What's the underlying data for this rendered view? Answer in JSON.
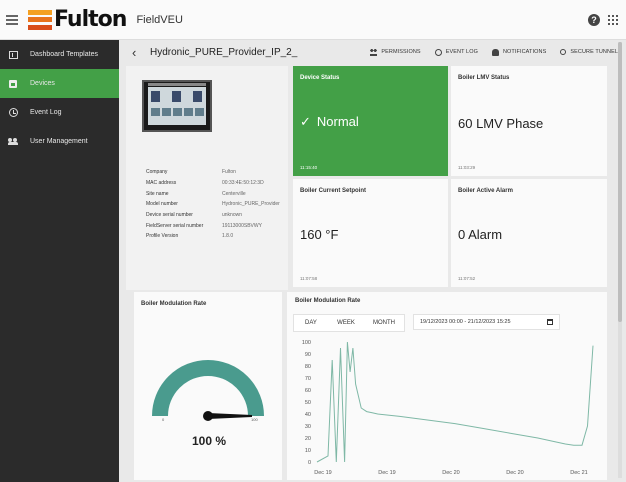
{
  "header": {
    "brand": "Fulton",
    "app_name": "FieldVEU",
    "help_icon": "help-icon",
    "apps_icon": "apps-grid-icon"
  },
  "sidebar": {
    "items": [
      {
        "label": "Dashboard Templates",
        "icon": "dashboard-icon",
        "active": false
      },
      {
        "label": "Devices",
        "icon": "device-icon",
        "active": true
      },
      {
        "label": "Event Log",
        "icon": "history-icon",
        "active": false
      },
      {
        "label": "User Management",
        "icon": "users-icon",
        "active": false
      }
    ]
  },
  "page": {
    "title": "Hydronic_PURE_Provider_IP_2_",
    "actions": [
      {
        "label": "PERMISSIONS",
        "icon": "people-icon"
      },
      {
        "label": "EVENT LOG",
        "icon": "history-icon"
      },
      {
        "label": "NOTIFICATIONS",
        "icon": "bell-icon"
      },
      {
        "label": "SECURE TUNNEL",
        "icon": "key-icon"
      }
    ]
  },
  "device": {
    "info": [
      {
        "label": "Company",
        "value": "Fulton"
      },
      {
        "label": "MAC address",
        "value": "00:33:4E:50:12:3D"
      },
      {
        "label": "Site name",
        "value": "Centerville"
      },
      {
        "label": "Model number",
        "value": "Hydronic_PURE_Provider"
      },
      {
        "label": "Device serial number",
        "value": "unknown"
      },
      {
        "label": "FieldServer serial number",
        "value": "19113000SBVWY"
      },
      {
        "label": "Profile Version",
        "value": "1.8.0"
      }
    ]
  },
  "cards": [
    {
      "title": "Device Status",
      "value": "Normal",
      "time": "11:15:40",
      "status_color": "#43a047"
    },
    {
      "title": "Boiler LMV Status",
      "value": "60 LMV Phase",
      "time": "11:03:29"
    },
    {
      "title": "Boiler Current Setpoint",
      "value": "160 °F",
      "time": "11:07:58"
    },
    {
      "title": "Boiler Active Alarm",
      "value": "0 Alarm",
      "time": "11:07:52"
    }
  ],
  "gauge": {
    "title": "Boiler Modulation Rate",
    "value_text": "100 %",
    "value": 100,
    "min_label": "0",
    "max_label": "100",
    "color": "#4a9b8e"
  },
  "trend": {
    "title": "Boiler Modulation Rate",
    "range_buttons": [
      "DAY",
      "WEEK",
      "MONTH"
    ],
    "date_range": "19/12/2023 00:00 - 21/12/2023 15:25"
  },
  "chart_data": {
    "type": "line",
    "title": "Boiler Modulation Rate",
    "xlabel": "",
    "ylabel": "",
    "ylim": [
      0,
      100
    ],
    "yticks": [
      0,
      10,
      20,
      30,
      40,
      50,
      60,
      70,
      80,
      90,
      100
    ],
    "xtick_labels": [
      "Dec 19",
      "Dec 19",
      "Dec 20",
      "Dec 20",
      "Dec 21"
    ],
    "grid": false,
    "color": "#7fb8a6",
    "x": [
      0.0,
      0.04,
      0.055,
      0.07,
      0.085,
      0.1,
      0.11,
      0.12,
      0.13,
      0.14,
      0.15,
      0.16,
      0.18,
      0.2,
      0.22,
      0.3,
      0.4,
      0.5,
      0.6,
      0.7,
      0.8,
      0.86,
      0.9,
      0.93,
      0.96,
      0.98,
      1.0
    ],
    "y": [
      0,
      5,
      85,
      0,
      95,
      0,
      100,
      75,
      95,
      65,
      55,
      45,
      42,
      41,
      40,
      38,
      35,
      32,
      28,
      24,
      20,
      17,
      15,
      14,
      14,
      30,
      97
    ]
  },
  "colors": {
    "sidebar_bg": "#2b2b2b",
    "accent": "#43a047",
    "line": "#7fb8a6"
  }
}
